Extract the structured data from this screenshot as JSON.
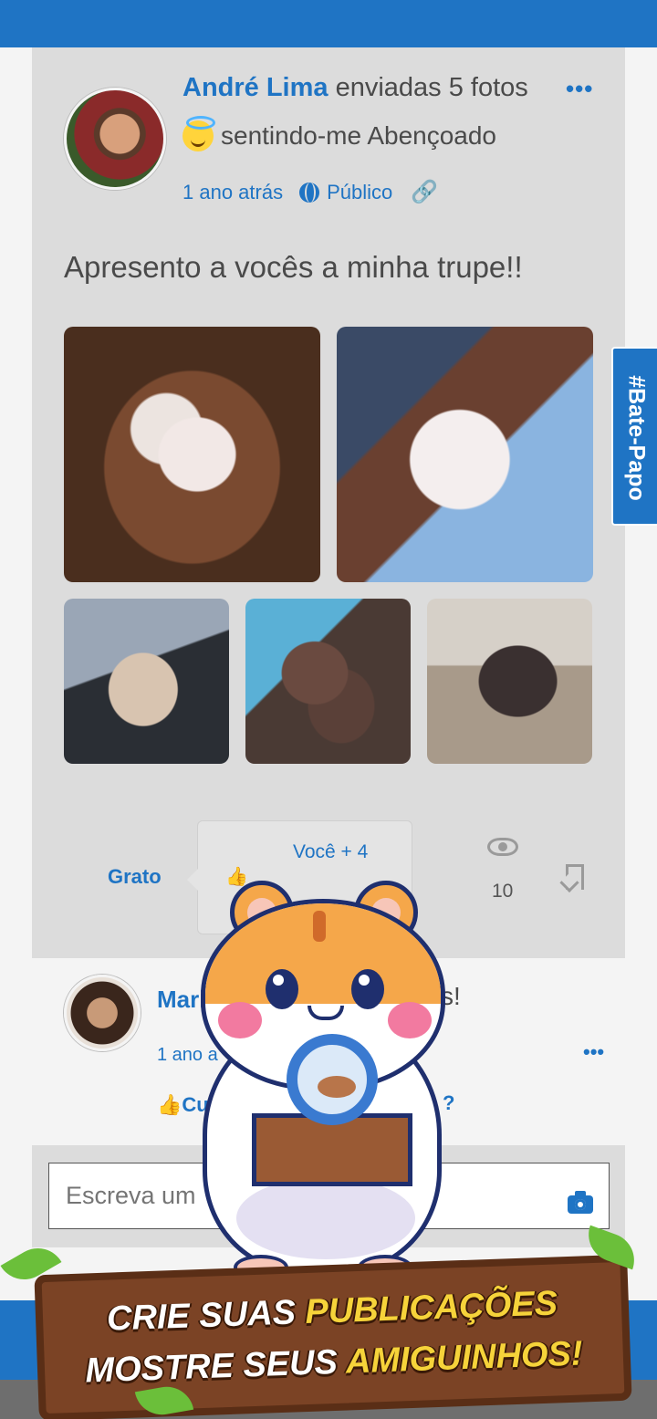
{
  "post": {
    "author": "André Lima",
    "action": "enviadas 5 fotos",
    "feeling_text": "sentindo-me Abençoado",
    "time": "1 ano atrás",
    "visibility": "Público",
    "text": "Apresento a vocês a minha trupe!!",
    "menu_icon": "•••"
  },
  "reactions": {
    "grato_label": "Grato",
    "you_plus": "Você + 4",
    "views": "10"
  },
  "comment": {
    "name_partial": "Mari",
    "text_partial": "s!",
    "time_partial": "1 ano a",
    "like_partial": "Curt",
    "reply_partial": "?",
    "menu_icon": "•••"
  },
  "composer": {
    "placeholder_visible": "Escreva um"
  },
  "side_tab": {
    "label": "#Bate-Papo"
  },
  "promo": {
    "line1_white": "CRIE SUAS ",
    "line1_yellow": "PUBLICAÇÕES",
    "line2_white": "MOSTRE SEUS ",
    "line2_yellow": "AMIGUINHOS!"
  },
  "colors": {
    "brand_blue": "#1f74c4",
    "card_gray": "#dcdcdc"
  }
}
